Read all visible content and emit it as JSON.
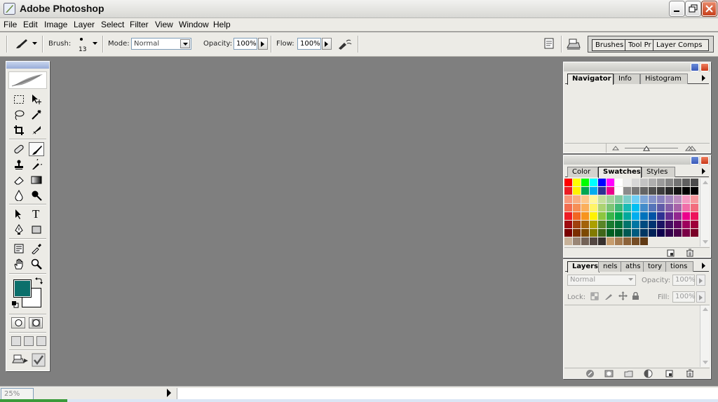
{
  "window": {
    "title": "Adobe Photoshop",
    "icon": "photoshop-feather-icon"
  },
  "menu": [
    "File",
    "Edit",
    "Image",
    "Layer",
    "Select",
    "Filter",
    "View",
    "Window",
    "Help"
  ],
  "options": {
    "tool_icon": "brush-icon",
    "brush_label": "Brush:",
    "brush_size": "13",
    "mode_label": "Mode:",
    "mode_value": "Normal",
    "opacity_label": "Opacity:",
    "opacity_value": "100%",
    "flow_label": "Flow:",
    "flow_value": "100%",
    "airbrush_icon": "airbrush-icon",
    "palette_well_tabs": [
      "Brushes",
      "Tool Pr",
      "Layer Comps"
    ]
  },
  "toolbox": {
    "tools": [
      "rectangular-marquee",
      "move",
      "lasso",
      "magic-wand",
      "crop",
      "slice",
      "healing-brush",
      "brush",
      "clone-stamp",
      "history-brush",
      "eraser",
      "gradient",
      "blur",
      "dodge",
      "path-selection",
      "type",
      "pen",
      "rectangle",
      "notes",
      "eyedropper",
      "hand",
      "zoom"
    ],
    "active_tool": "brush",
    "type_tool_glyph": "T",
    "foreground_color": "#0b6f6b",
    "background_color": "#ffffff"
  },
  "navigator_palette": {
    "tabs": [
      "Navigator",
      "Info",
      "Histogram"
    ],
    "active": "Navigator"
  },
  "swatches_palette": {
    "tabs": [
      "Color",
      "Swatches",
      "Styles"
    ],
    "active": "Swatches",
    "swatches": [
      [
        "#ff0000",
        "#ffff00",
        "#00ff00",
        "#00ffff",
        "#0000ff",
        "#ff00ff",
        "#ffffff",
        "#ebebeb",
        "#d7d7d7",
        "#c3c3c3",
        "#afafaf",
        "#9b9b9b",
        "#878787",
        "#737373",
        "#5f5f5f",
        "#4b4b4b"
      ],
      [
        "#ed1c24",
        "#fff200",
        "#00a651",
        "#00aeef",
        "#2e3192",
        "#ec008c",
        "#ffffff",
        "#8c8c8c",
        "#787878",
        "#646464",
        "#505050",
        "#3c3c3c",
        "#282828",
        "#141414",
        "#000000",
        "#000000"
      ],
      [
        "#f7977a",
        "#f9ad81",
        "#fdc68a",
        "#fff79a",
        "#c4df9b",
        "#a3d39c",
        "#82ca9d",
        "#7bcdc8",
        "#6ecff6",
        "#7ea7d8",
        "#8493ca",
        "#8882be",
        "#a187be",
        "#bc8dbf",
        "#f49ac2",
        "#f6989d"
      ],
      [
        "#f26c4f",
        "#f68e55",
        "#fbaf5c",
        "#fff467",
        "#acd372",
        "#7cc576",
        "#3bb878",
        "#1abbb4",
        "#00bff3",
        "#438cca",
        "#5574b9",
        "#605ca8",
        "#855fa8",
        "#a763a8",
        "#f06ea9",
        "#f26d7d"
      ],
      [
        "#ed1c24",
        "#f26522",
        "#f7941d",
        "#fff200",
        "#8dc63f",
        "#39b54a",
        "#00a651",
        "#00a99d",
        "#00aeef",
        "#0072bc",
        "#0054a6",
        "#2e3192",
        "#662d91",
        "#92278f",
        "#ec008c",
        "#ed145b"
      ],
      [
        "#9e0b0f",
        "#a0410d",
        "#a3620a",
        "#aba000",
        "#598527",
        "#197b30",
        "#007236",
        "#00746b",
        "#0076a3",
        "#004b80",
        "#003471",
        "#1b1464",
        "#440e62",
        "#630460",
        "#9e005d",
        "#9e0039"
      ],
      [
        "#790000",
        "#7b2e00",
        "#7d4900",
        "#827b00",
        "#406618",
        "#005e20",
        "#005826",
        "#005952",
        "#005b7f",
        "#003663",
        "#002157",
        "#0d004c",
        "#32004b",
        "#4b0049",
        "#7b0046",
        "#7a0026"
      ],
      [
        "#c7b299",
        "#998675",
        "#736357",
        "#534741",
        "#37302d",
        "#c69c6d",
        "#a67c52",
        "#8c6239",
        "#754c24",
        "#603913",
        "#ecebe6",
        "#ecebe6",
        "#ecebe6",
        "#ecebe6",
        "#ecebe6",
        "#ecebe6"
      ]
    ]
  },
  "layers_palette": {
    "tabs": [
      "Layers",
      "nels",
      "aths",
      "tory",
      "tions"
    ],
    "active": "Layers",
    "blend_mode": "Normal",
    "opacity_label": "Opacity:",
    "opacity_value": "100%",
    "lock_label": "Lock:",
    "fill_label": "Fill:",
    "fill_value": "100%"
  },
  "status": {
    "zoom": "25%"
  }
}
